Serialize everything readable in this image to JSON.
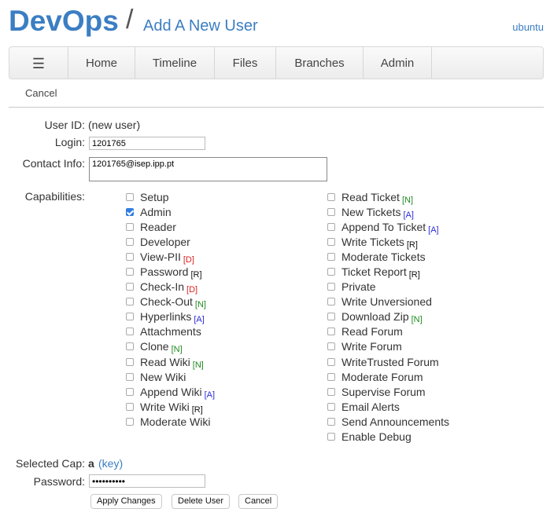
{
  "header": {
    "logo": "DevOps",
    "separator": "/",
    "title": "Add A New User",
    "user": "ubuntu"
  },
  "nav": {
    "menu_icon": "☰",
    "items": [
      "Home",
      "Timeline",
      "Files",
      "Branches",
      "Admin"
    ]
  },
  "submenu": {
    "cancel": "Cancel"
  },
  "form": {
    "user_id_label": "User ID:",
    "user_id_value": "(new user)",
    "login_label": "Login:",
    "login_value": "1201765",
    "contact_label": "Contact Info:",
    "contact_value": "1201765@isep.ipp.pt",
    "capabilities_label": "Capabilities:",
    "selected_cap_label": "Selected Cap:",
    "selected_cap_value": "a",
    "selected_cap_key": "(key)",
    "password_label": "Password:",
    "password_value": "••••••••••"
  },
  "capabilities_left": [
    {
      "label": "Setup",
      "checked": false,
      "tag": ""
    },
    {
      "label": "Admin",
      "checked": true,
      "tag": ""
    },
    {
      "label": "Reader",
      "checked": false,
      "tag": ""
    },
    {
      "label": "Developer",
      "checked": false,
      "tag": ""
    },
    {
      "label": "View-PII",
      "checked": false,
      "tag": "[D]"
    },
    {
      "label": "Password",
      "checked": false,
      "tag": "[R]"
    },
    {
      "label": "Check-In",
      "checked": false,
      "tag": "[D]"
    },
    {
      "label": "Check-Out",
      "checked": false,
      "tag": "[N]"
    },
    {
      "label": "Hyperlinks",
      "checked": false,
      "tag": "[A]"
    },
    {
      "label": "Attachments",
      "checked": false,
      "tag": ""
    },
    {
      "label": "Clone",
      "checked": false,
      "tag": "[N]"
    },
    {
      "label": "Read Wiki",
      "checked": false,
      "tag": "[N]"
    },
    {
      "label": "New Wiki",
      "checked": false,
      "tag": ""
    },
    {
      "label": "Append Wiki",
      "checked": false,
      "tag": "[A]"
    },
    {
      "label": "Write Wiki",
      "checked": false,
      "tag": "[R]"
    },
    {
      "label": "Moderate Wiki",
      "checked": false,
      "tag": ""
    }
  ],
  "capabilities_right": [
    {
      "label": "Read Ticket",
      "checked": false,
      "tag": "[N]"
    },
    {
      "label": "New Tickets",
      "checked": false,
      "tag": "[A]"
    },
    {
      "label": "Append To Ticket",
      "checked": false,
      "tag": "[A]"
    },
    {
      "label": "Write Tickets",
      "checked": false,
      "tag": "[R]"
    },
    {
      "label": "Moderate Tickets",
      "checked": false,
      "tag": ""
    },
    {
      "label": "Ticket Report",
      "checked": false,
      "tag": "[R]"
    },
    {
      "label": "Private",
      "checked": false,
      "tag": ""
    },
    {
      "label": "Write Unversioned",
      "checked": false,
      "tag": ""
    },
    {
      "label": "Download Zip",
      "checked": false,
      "tag": "[N]"
    },
    {
      "label": "Read Forum",
      "checked": false,
      "tag": ""
    },
    {
      "label": "Write Forum",
      "checked": false,
      "tag": ""
    },
    {
      "label": "WriteTrusted Forum",
      "checked": false,
      "tag": ""
    },
    {
      "label": "Moderate Forum",
      "checked": false,
      "tag": ""
    },
    {
      "label": "Supervise Forum",
      "checked": false,
      "tag": ""
    },
    {
      "label": "Email Alerts",
      "checked": false,
      "tag": ""
    },
    {
      "label": "Send Announcements",
      "checked": false,
      "tag": ""
    },
    {
      "label": "Enable Debug",
      "checked": false,
      "tag": ""
    }
  ],
  "tag_colors": {
    "[D]": "#e02020",
    "[N]": "#1f8a1f",
    "[A]": "#2a2adc",
    "[R]": "#111111"
  },
  "buttons": {
    "apply": "Apply Changes",
    "delete": "Delete User",
    "cancel": "Cancel"
  }
}
